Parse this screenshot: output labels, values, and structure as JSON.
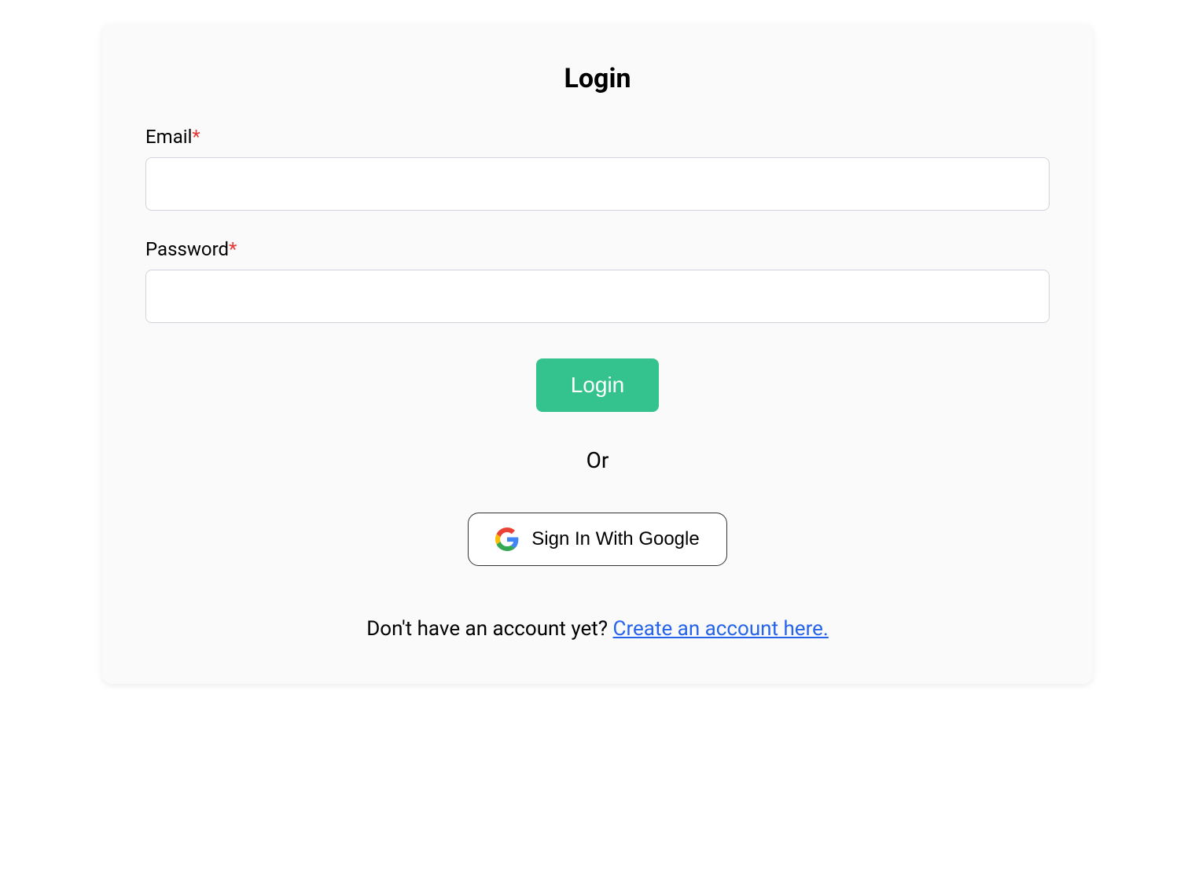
{
  "title": "Login",
  "form": {
    "email_label": "Email",
    "password_label": "Password",
    "required_mark": "*"
  },
  "login_button_label": "Login",
  "divider_label": "Or",
  "google_button_label": "Sign In With Google",
  "signup_prompt": "Don't have an account yet? ",
  "signup_link_text": "Create an account here.",
  "colors": {
    "accent": "#34c38f",
    "link": "#2563eb",
    "required": "#e53935"
  }
}
